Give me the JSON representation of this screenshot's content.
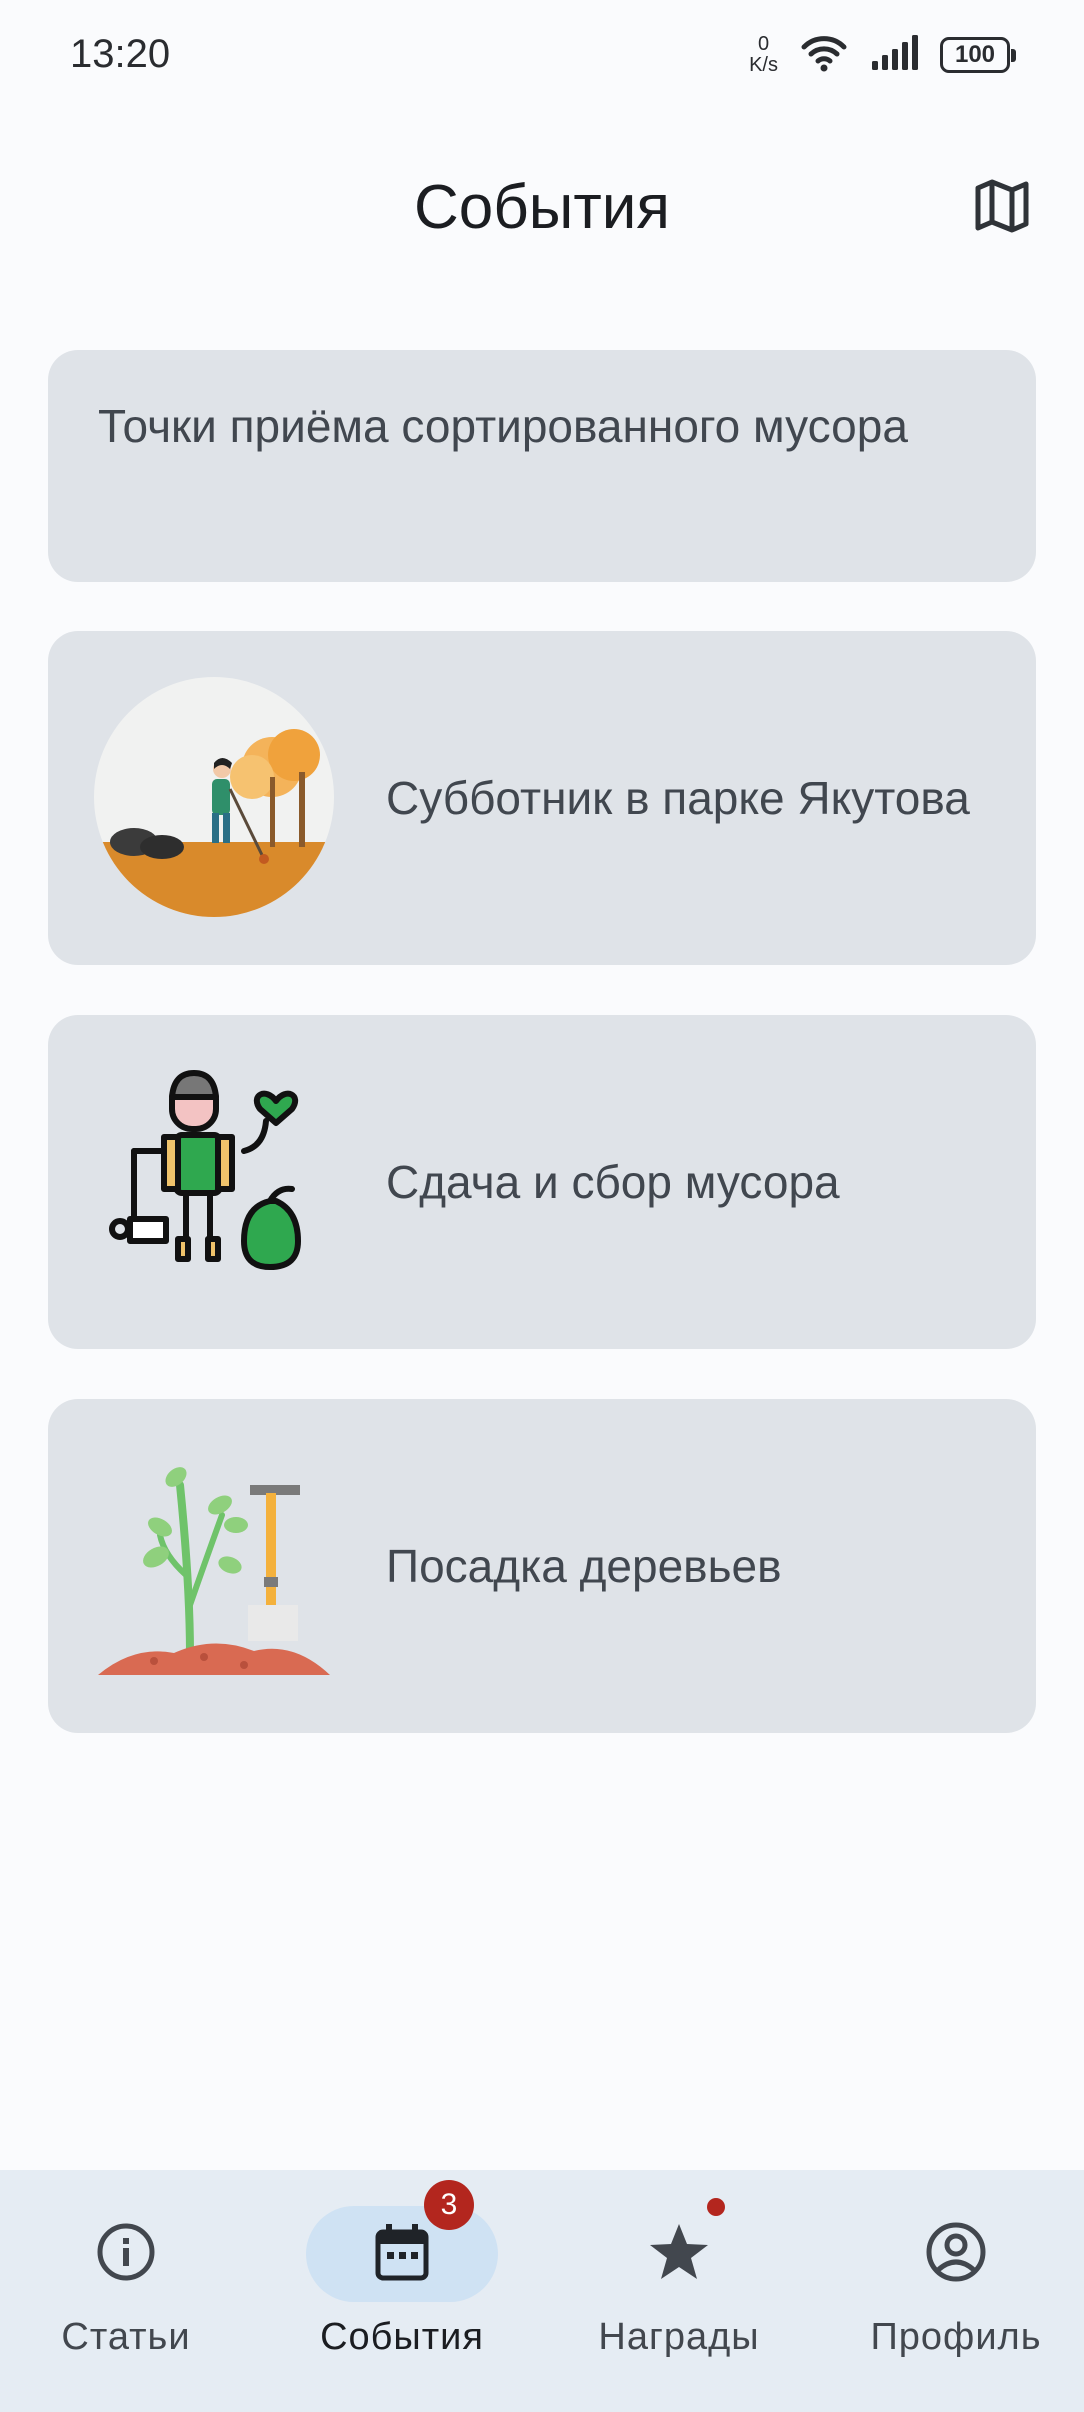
{
  "status_bar": {
    "time": "13:20",
    "net_speed_value": "0",
    "net_speed_unit": "K/s",
    "battery": "100",
    "icons": [
      "wifi-icon",
      "signal-icon",
      "battery-icon"
    ]
  },
  "header": {
    "title": "События",
    "map_icon": "map-icon"
  },
  "events": [
    {
      "title": "Точки приёма сортированного мусора",
      "image": "none"
    },
    {
      "title": "Субботник в парке Якутова",
      "image": "cleanup-park-illustration"
    },
    {
      "title": "Сдача и сбор мусора",
      "image": "volunteer-trash-illustration"
    },
    {
      "title": "Посадка деревьев",
      "image": "tree-planting-illustration"
    }
  ],
  "bottom_nav": {
    "items": [
      {
        "label": "Статьи",
        "icon": "info-icon"
      },
      {
        "label": "События",
        "icon": "calendar-icon",
        "badge": "3",
        "active": true
      },
      {
        "label": "Награды",
        "icon": "star-icon",
        "dot": true
      },
      {
        "label": "Профиль",
        "icon": "account-icon"
      }
    ]
  },
  "colors": {
    "background": "#fafbfd",
    "card": "#dfe3e8",
    "nav_bar": "#e5ecf3",
    "active_pill": "#cfe2f3",
    "badge": "#b3261e"
  }
}
